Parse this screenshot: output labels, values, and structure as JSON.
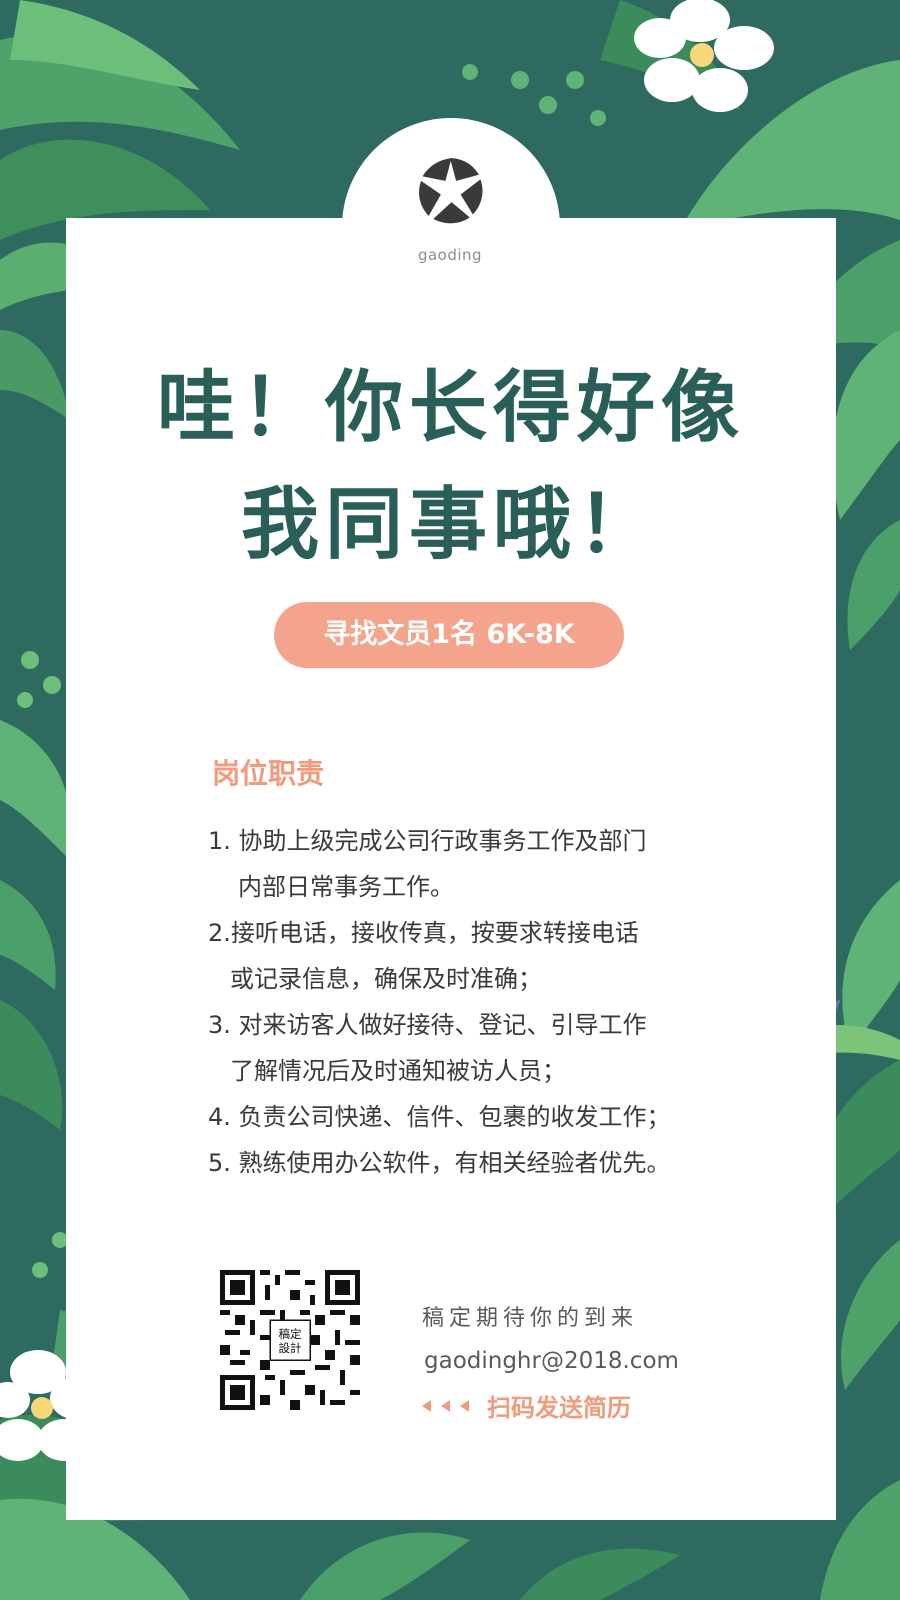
{
  "brand": {
    "logo_text": "gaoding",
    "logo_icon": "aperture-logo-icon"
  },
  "headline": {
    "line1": "哇！你长得好像",
    "line2": "我同事哦！"
  },
  "job_pill": "寻找文员1名  6K-8K",
  "duties": {
    "title": "岗位职责",
    "items": [
      {
        "line1": "1. 协助上级完成公司行政事务工作及部门",
        "line2": "内部日常事务工作。"
      },
      {
        "line1": "2.接听电话，接收传真，按要求转接电话",
        "line2": "或记录信息，确保及时准确；"
      },
      {
        "line1": "3. 对来访客人做好接待、登记、引导工作",
        "line2": "了解情况后及时通知被访人员；"
      },
      {
        "line1": "4. 负责公司快递、信件、包裹的收发工作；",
        "line2": ""
      },
      {
        "line1": "5. 熟练使用办公软件，有相关经验者优先。",
        "line2": ""
      }
    ]
  },
  "contact": {
    "tagline": "稿定期待你的到来",
    "email": "gaodinghr@2018.com",
    "scan_label": "扫码发送简历",
    "qr_center_label_line1": "稿定",
    "qr_center_label_line2": "設計"
  },
  "colors": {
    "background": "#2e6a5f",
    "headline": "#2a5e58",
    "accent": "#f4a48c",
    "accent_text": "#f29a7c"
  }
}
